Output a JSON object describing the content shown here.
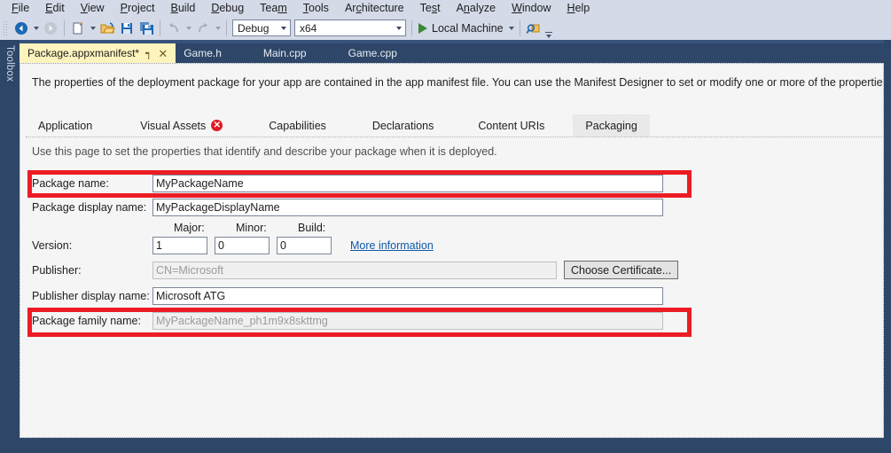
{
  "menubar": {
    "items": [
      {
        "label": "File",
        "accel": "F"
      },
      {
        "label": "Edit",
        "accel": "E"
      },
      {
        "label": "View",
        "accel": "V"
      },
      {
        "label": "Project",
        "accel": "P"
      },
      {
        "label": "Build",
        "accel": "B"
      },
      {
        "label": "Debug",
        "accel": "D"
      },
      {
        "label": "Team",
        "accel": "m"
      },
      {
        "label": "Tools",
        "accel": "T"
      },
      {
        "label": "Architecture",
        "accel": "c"
      },
      {
        "label": "Test",
        "accel": "s"
      },
      {
        "label": "Analyze",
        "accel": "n"
      },
      {
        "label": "Window",
        "accel": "W"
      },
      {
        "label": "Help",
        "accel": "H"
      }
    ]
  },
  "toolbar": {
    "navigate_back_icon": "navigate-back-icon",
    "navigate_forward_icon": "navigate-forward-icon",
    "new_item_icon": "new-item-icon",
    "open_file_icon": "open-file-icon",
    "save_icon": "save-icon",
    "save_all_icon": "save-all-icon",
    "undo_icon": "undo-icon",
    "redo_icon": "redo-icon",
    "configuration": "Debug",
    "platform": "x64",
    "run_target": "Local Machine",
    "run_icon": "play-icon",
    "find_icon": "find-in-files-icon",
    "overflow_icon": "toolbar-overflow-icon"
  },
  "toolbox": {
    "label": "Toolbox"
  },
  "document_tabs": {
    "items": [
      {
        "label": "Package.appxmanifest*",
        "active": true,
        "pin": "┑",
        "close": "✕"
      },
      {
        "label": "Game.h",
        "active": false
      },
      {
        "label": "Main.cpp",
        "active": false
      },
      {
        "label": "Game.cpp",
        "active": false
      }
    ]
  },
  "designer": {
    "intro": "The properties of the deployment package for your app are contained in the app manifest file. You can use the Manifest Designer to set or modify one or more of the properties.",
    "page_tabs": [
      {
        "label": "Application",
        "active": false,
        "error": false
      },
      {
        "label": "Visual Assets",
        "active": false,
        "error": true,
        "error_glyph": "✕"
      },
      {
        "label": "Capabilities",
        "active": false,
        "error": false
      },
      {
        "label": "Declarations",
        "active": false,
        "error": false
      },
      {
        "label": "Content URIs",
        "active": false,
        "error": false
      },
      {
        "label": "Packaging",
        "active": true,
        "error": false
      }
    ],
    "hint": "Use this page to set the properties that identify and describe your package when it is deployed.",
    "fields": {
      "package_name_label": "Package name:",
      "package_name_value": "MyPackageName",
      "package_display_name_label": "Package display name:",
      "package_display_name_value": "MyPackageDisplayName",
      "version_label": "Version:",
      "major_label": "Major:",
      "major_value": "1",
      "minor_label": "Minor:",
      "minor_value": "0",
      "build_label": "Build:",
      "build_value": "0",
      "more_information_link": "More information",
      "publisher_label": "Publisher:",
      "publisher_value": "CN=Microsoft",
      "choose_certificate_button": "Choose Certificate...",
      "publisher_display_name_label": "Publisher display name:",
      "publisher_display_name_value": "Microsoft ATG",
      "package_family_name_label": "Package family name:",
      "package_family_name_value": "MyPackageName_ph1m9x8skttmg"
    }
  },
  "annotations": {
    "highlight_color": "#ec1c24",
    "highlighted_fields": [
      "package-name-row",
      "package-family-name-row"
    ]
  },
  "theme": {
    "chrome_dark": "#2e4668",
    "menubar_bg": "#d4dae8",
    "active_tab_bg": "#fdf4bd",
    "surface_bg": "#f5f5f5",
    "link_color": "#0f5aa8",
    "error_red": "#e01b24",
    "run_green": "#3a8a3a"
  }
}
